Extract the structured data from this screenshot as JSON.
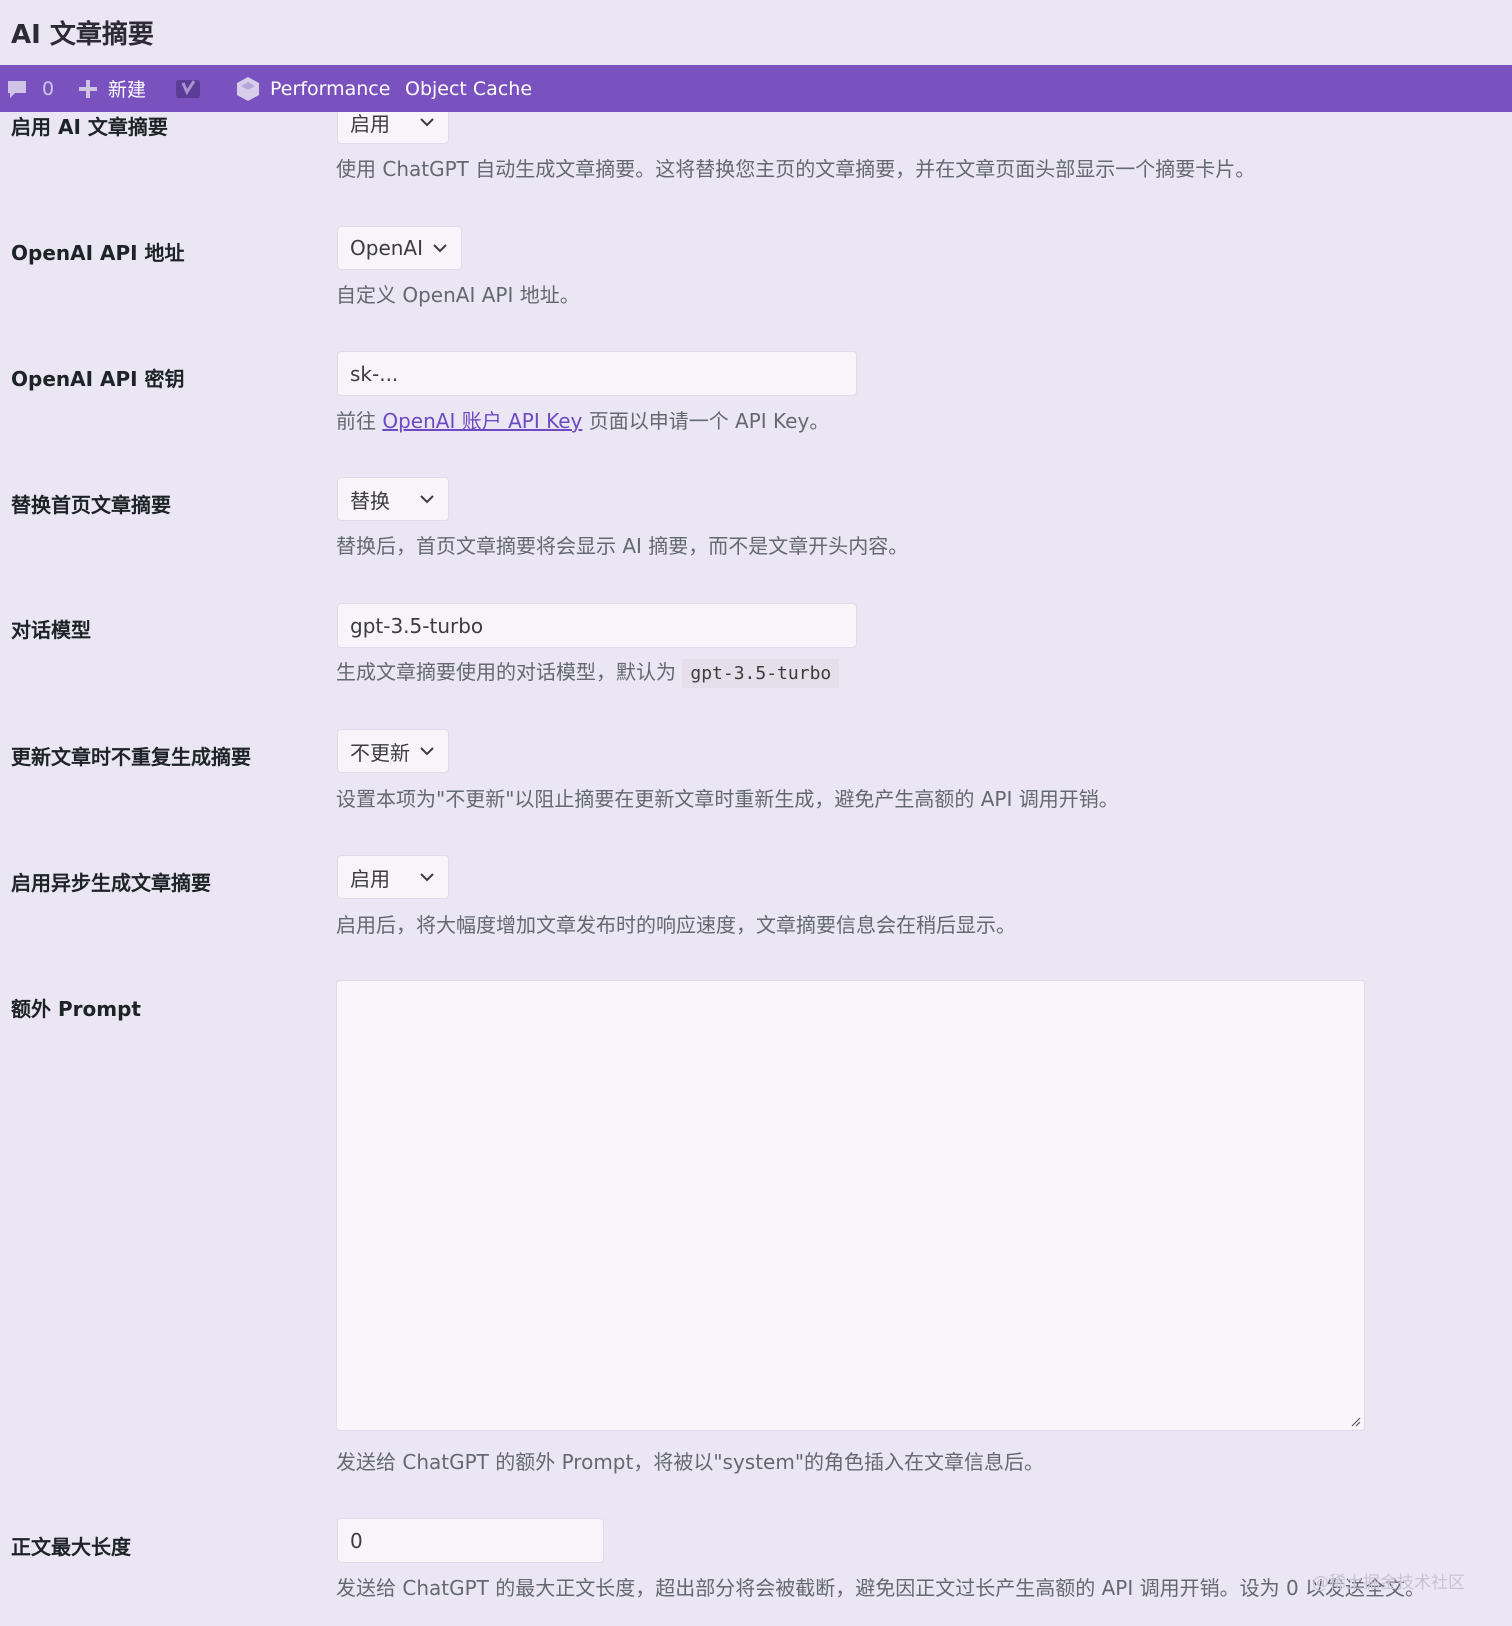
{
  "page": {
    "title": "AI 文章摘要"
  },
  "adminbar": {
    "comments_count": "0",
    "new_label": "新建",
    "performance_label": "Performance",
    "object_cache_label": "Object Cache"
  },
  "settings": {
    "enable": {
      "label": "启用 AI 文章摘要",
      "value": "启用",
      "description": "使用 ChatGPT 自动生成文章摘要。这将替换您主页的文章摘要，并在文章页面头部显示一个摘要卡片。"
    },
    "api_url": {
      "label": "OpenAI API 地址",
      "value": "OpenAI",
      "description": "自定义 OpenAI API 地址。"
    },
    "api_key": {
      "label": "OpenAI API 密钥",
      "value": "sk-...",
      "desc_before": "前往 ",
      "desc_link": "OpenAI 账户 API Key",
      "desc_after": " 页面以申请一个 API Key。"
    },
    "replace_excerpt": {
      "label": "替换首页文章摘要",
      "value": "替换",
      "description": "替换后，首页文章摘要将会显示 AI 摘要，而不是文章开头内容。"
    },
    "model": {
      "label": "对话模型",
      "value": "gpt-3.5-turbo",
      "desc_before": "生成文章摘要使用的对话模型，默认为 ",
      "desc_code": "gpt-3.5-turbo"
    },
    "no_regen": {
      "label": "更新文章时不重复生成摘要",
      "value": "不更新",
      "description": "设置本项为\"不更新\"以阻止摘要在更新文章时重新生成，避免产生高额的 API 调用开销。"
    },
    "async": {
      "label": "启用异步生成文章摘要",
      "value": "启用",
      "description": "启用后，将大幅度增加文章发布时的响应速度，文章摘要信息会在稍后显示。"
    },
    "extra_prompt": {
      "label": "额外 Prompt",
      "value": "",
      "description": "发送给 ChatGPT 的额外 Prompt，将被以\"system\"的角色插入在文章信息后。"
    },
    "max_length": {
      "label": "正文最大长度",
      "value": "0",
      "description": "发送给 ChatGPT 的最大正文长度，超出部分将会被截断，避免因正文过长产生高额的 API 调用开销。设为 0 以发送全文。"
    }
  },
  "watermark": "@稀土掘金技术社区"
}
